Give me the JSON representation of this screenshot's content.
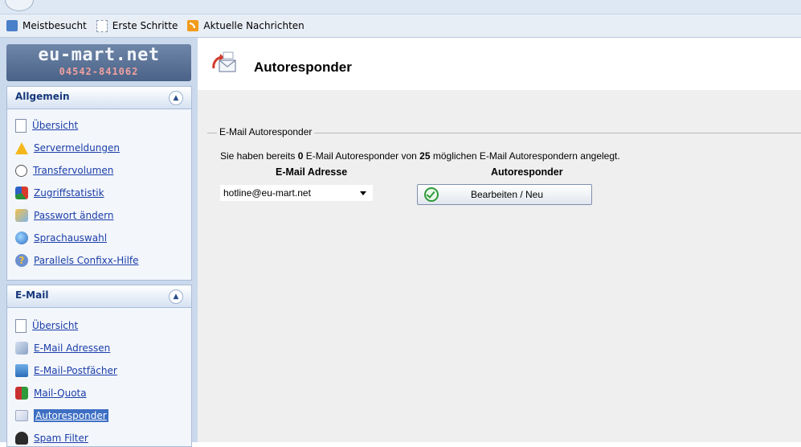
{
  "bookmarks": [
    {
      "label": "Meistbesucht",
      "icon": "bookmark-icon"
    },
    {
      "label": "Erste Schritte",
      "icon": "page-icon"
    },
    {
      "label": "Aktuelle Nachrichten",
      "icon": "rss-icon"
    }
  ],
  "logo": {
    "name": "eu-mart.net",
    "phone": "04542-841062"
  },
  "sidebar": {
    "allgemein": {
      "title": "Allgemein",
      "items": [
        {
          "label": "Übersicht",
          "icon": "page-icon"
        },
        {
          "label": "Servermeldungen",
          "icon": "warning-icon"
        },
        {
          "label": "Transfervolumen",
          "icon": "transfer-icon"
        },
        {
          "label": "Zugriffstatistik",
          "icon": "statistics-icon"
        },
        {
          "label": "Passwort ändern",
          "icon": "password-icon"
        },
        {
          "label": "Sprachauswahl",
          "icon": "globe-icon"
        },
        {
          "label": "Parallels Confixx-Hilfe",
          "icon": "help-icon"
        }
      ]
    },
    "email": {
      "title": "E-Mail",
      "items": [
        {
          "label": "Übersicht",
          "icon": "page-icon"
        },
        {
          "label": "E-Mail Adressen",
          "icon": "email-address-icon"
        },
        {
          "label": "E-Mail-Postfächer",
          "icon": "mailbox-icon"
        },
        {
          "label": "Mail-Quota",
          "icon": "quota-icon"
        },
        {
          "label": "Autoresponder",
          "icon": "autoresponder-icon",
          "active": true
        },
        {
          "label": "Spam Filter",
          "icon": "spam-filter-icon"
        }
      ]
    }
  },
  "main": {
    "title": "Autoresponder",
    "fieldset_legend": "E-Mail Autoresponder",
    "info": {
      "prefix": "Sie haben bereits ",
      "count": "0",
      "middle": " E-Mail Autoresponder von ",
      "max": "25",
      "suffix": " möglichen E-Mail Autorespondern angelegt."
    },
    "col_email": "E-Mail Adresse",
    "col_autoresponder": "Autoresponder",
    "selected_email": "hotline@eu-mart.net",
    "edit_button": "Bearbeiten / Neu"
  },
  "colors": {
    "sidebar_bg": "#cbd9ed",
    "panel_title": "#16387a",
    "link": "#1a3ea8",
    "active_bg": "#3e6fc4",
    "content_bg": "#efefef"
  }
}
